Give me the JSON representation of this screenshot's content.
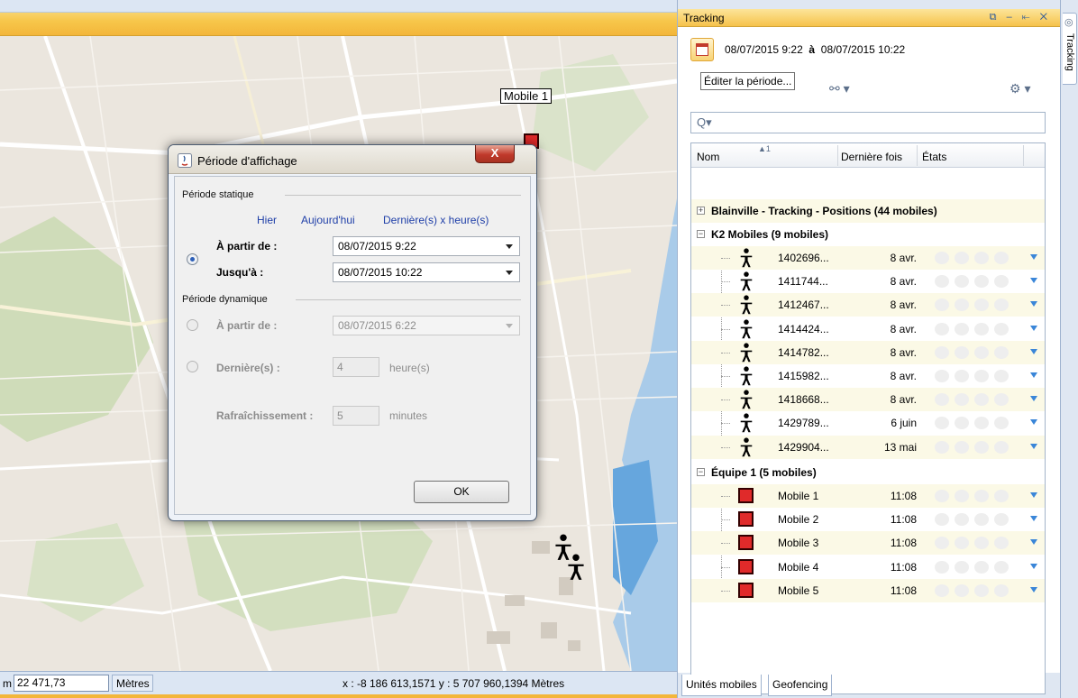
{
  "map": {
    "label_mobile1": "Mobile 1",
    "scale_prefix": "m",
    "scale_value": "22 471,73",
    "scale_unit": "Mètres",
    "coords": "x : -8 186 613,1571   y : 5 707 960,1394 Mètres"
  },
  "dialog": {
    "title": "Période d'affichage",
    "close_label": "X",
    "static": {
      "header": "Période statique",
      "links": [
        "Hier",
        "Aujourd'hui",
        "Dernière(s) x heure(s)"
      ],
      "from_label": "À partir de :",
      "from_value": "08/07/2015 9:22",
      "to_label": "Jusqu'à :",
      "to_value": "08/07/2015 10:22"
    },
    "dynamic": {
      "header": "Période dynamique",
      "from_label": "À partir de :",
      "from_value": "08/07/2015 6:22",
      "last_label": "Dernière(s) :",
      "last_value": "4",
      "last_unit": "heure(s)",
      "refresh_label": "Rafraîchissement :",
      "refresh_value": "5",
      "refresh_unit": "minutes"
    },
    "ok_label": "OK"
  },
  "panel": {
    "title": "Tracking",
    "period": {
      "from": "08/07/2015  9:22",
      "sep": "à",
      "to": "08/07/2015  10:22"
    },
    "tooltip": "Éditer la période...",
    "search_placeholder": "Q▾",
    "columns": {
      "name": "Nom",
      "sort_indicator": "▲1",
      "last": "Dernière fois",
      "states": "États"
    },
    "groups": {
      "blainville": "Blainville - Tracking - Positions (44 mobiles)",
      "k2": "K2 Mobiles (9 mobiles)",
      "equipe": "Équipe 1 (5 mobiles)"
    },
    "k2_rows": [
      {
        "name": "1402696...",
        "time": "8 avr."
      },
      {
        "name": "1411744...",
        "time": "8 avr."
      },
      {
        "name": "1412467...",
        "time": "8 avr."
      },
      {
        "name": "1414424...",
        "time": "8 avr."
      },
      {
        "name": "1414782...",
        "time": "8 avr."
      },
      {
        "name": "1415982...",
        "time": "8 avr."
      },
      {
        "name": "1418668...",
        "time": "8 avr."
      },
      {
        "name": "1429789...",
        "time": "6 juin"
      },
      {
        "name": "1429904...",
        "time": "13 mai"
      }
    ],
    "equipe_rows": [
      {
        "name": "Mobile 1",
        "time": "11:08"
      },
      {
        "name": "Mobile 2",
        "time": "11:08"
      },
      {
        "name": "Mobile 3",
        "time": "11:08"
      },
      {
        "name": "Mobile 4",
        "time": "11:08"
      },
      {
        "name": "Mobile 5",
        "time": "11:08"
      }
    ],
    "bottom_tabs": [
      "Unités mobiles",
      "Geofencing"
    ],
    "side_tab": "Tracking"
  },
  "colors": {
    "accent_orange": "#f6c24b",
    "panel_blue": "#dfe7f2",
    "marker_red": "#e02a2a",
    "link_blue": "#1f3fa8"
  }
}
